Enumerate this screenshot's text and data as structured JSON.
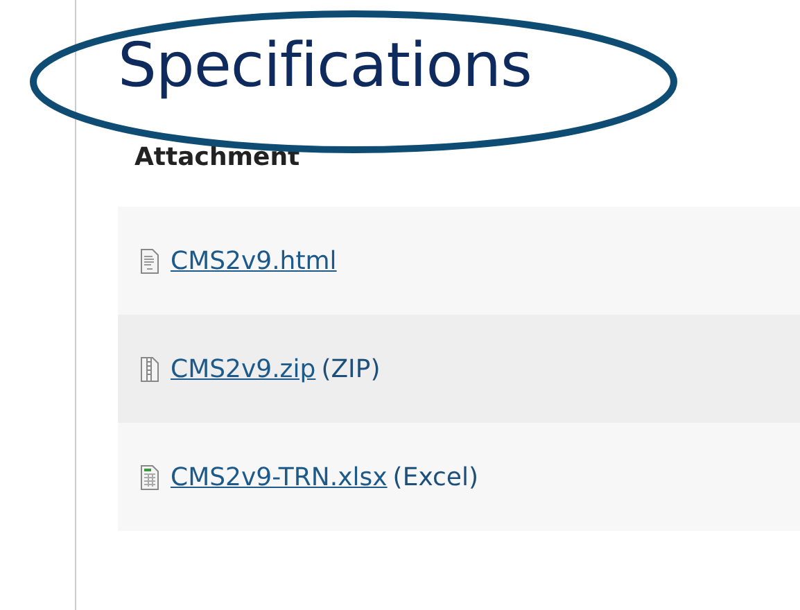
{
  "heading": "Specifications",
  "table": {
    "column_header": "Attachment",
    "rows": [
      {
        "kind": "document",
        "file": "CMS2v9.html"
      },
      {
        "kind": "archive",
        "file": "CMS2v9.zip",
        "type": "(ZIP)"
      },
      {
        "kind": "spreadsheet",
        "file": "CMS2v9-TRN.xlsx",
        "type": "(Excel)"
      }
    ]
  }
}
